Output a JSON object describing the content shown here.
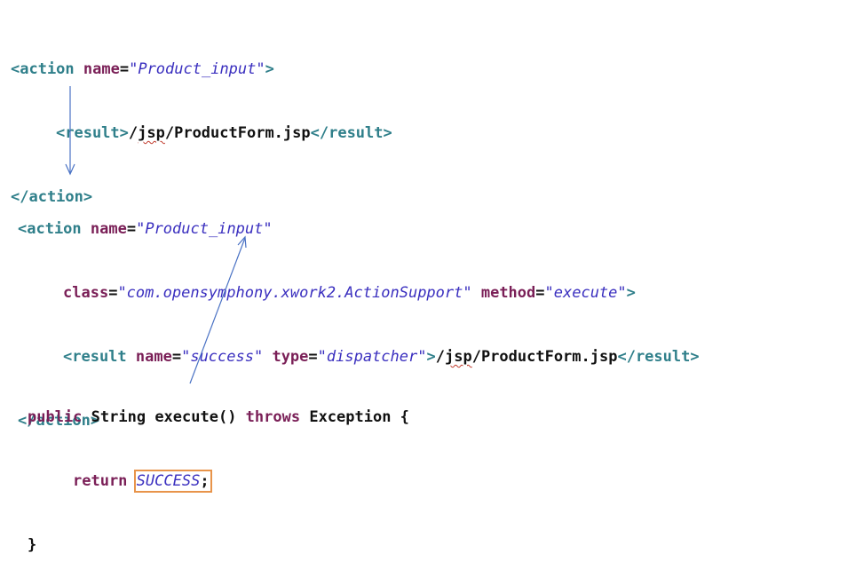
{
  "block1": {
    "line1": {
      "open": "<action",
      "attr": " name",
      "eq": "=",
      "value": "\"Product_input\"",
      "close": ">"
    },
    "line2": {
      "open": "<result>",
      "path_pre": "/",
      "path_jsp": "jsp",
      "path_post": "/ProductForm.jsp",
      "close": "</result>"
    },
    "line3": {
      "close": "</action>"
    }
  },
  "block2": {
    "line1": {
      "open": "<action",
      "attr": " name",
      "eq": "=",
      "value": "\"Product_input\""
    },
    "line2": {
      "attr_class": "class",
      "eq1": "=",
      "value_class": "\"com.opensymphony.xwork2.ActionSupport\"",
      "attr_method": " method",
      "eq2": "=",
      "value_method": "\"execute\"",
      "close": ">"
    },
    "line3": {
      "open": "<result",
      "attr_name": " name",
      "eq1": "=",
      "value_name": "\"success\"",
      "attr_type": " type",
      "eq2": "=",
      "value_type": "\"dispatcher\"",
      "close_open": ">",
      "path_pre": "/",
      "path_jsp": "jsp",
      "path_post": "/ProductForm.jsp",
      "close": "</result>"
    },
    "line4": {
      "close": "</action>"
    }
  },
  "block3": {
    "line1": {
      "kw_public": "public",
      "type": " String ",
      "method": "execute() ",
      "kw_throws": "throws",
      "rest": " Exception {"
    },
    "line2": {
      "kw_return": "return",
      "space": " ",
      "constant": "SUCCESS",
      "semi": ";"
    },
    "line3": {
      "close": "}"
    }
  },
  "colors": {
    "tag": "#2f7f8a",
    "keyword": "#7a1f57",
    "value": "#3a2fbf",
    "arrow": "#4a72c4",
    "highlight_box": "#e8944a"
  }
}
